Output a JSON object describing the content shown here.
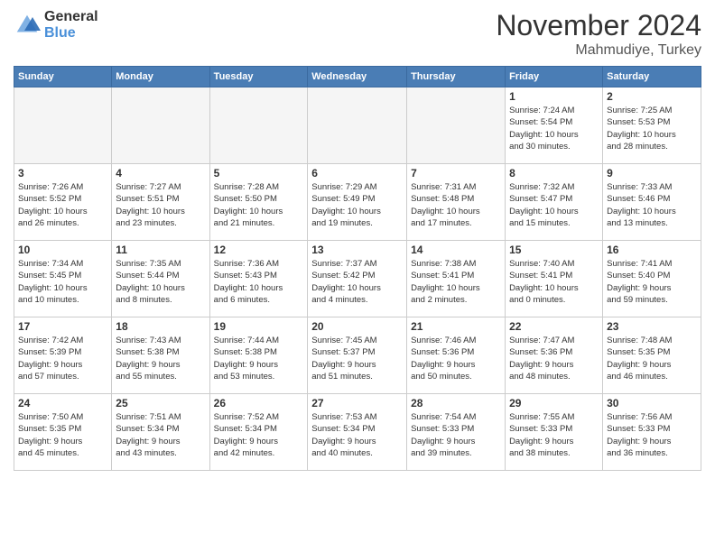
{
  "logo": {
    "general": "General",
    "blue": "Blue"
  },
  "title": "November 2024",
  "location": "Mahmudiye, Turkey",
  "weekdays": [
    "Sunday",
    "Monday",
    "Tuesday",
    "Wednesday",
    "Thursday",
    "Friday",
    "Saturday"
  ],
  "weeks": [
    [
      {
        "day": "",
        "empty": true
      },
      {
        "day": "",
        "empty": true
      },
      {
        "day": "",
        "empty": true
      },
      {
        "day": "",
        "empty": true
      },
      {
        "day": "",
        "empty": true
      },
      {
        "day": "1",
        "info": "Sunrise: 7:24 AM\nSunset: 5:54 PM\nDaylight: 10 hours\nand 30 minutes."
      },
      {
        "day": "2",
        "info": "Sunrise: 7:25 AM\nSunset: 5:53 PM\nDaylight: 10 hours\nand 28 minutes."
      }
    ],
    [
      {
        "day": "3",
        "info": "Sunrise: 7:26 AM\nSunset: 5:52 PM\nDaylight: 10 hours\nand 26 minutes."
      },
      {
        "day": "4",
        "info": "Sunrise: 7:27 AM\nSunset: 5:51 PM\nDaylight: 10 hours\nand 23 minutes."
      },
      {
        "day": "5",
        "info": "Sunrise: 7:28 AM\nSunset: 5:50 PM\nDaylight: 10 hours\nand 21 minutes."
      },
      {
        "day": "6",
        "info": "Sunrise: 7:29 AM\nSunset: 5:49 PM\nDaylight: 10 hours\nand 19 minutes."
      },
      {
        "day": "7",
        "info": "Sunrise: 7:31 AM\nSunset: 5:48 PM\nDaylight: 10 hours\nand 17 minutes."
      },
      {
        "day": "8",
        "info": "Sunrise: 7:32 AM\nSunset: 5:47 PM\nDaylight: 10 hours\nand 15 minutes."
      },
      {
        "day": "9",
        "info": "Sunrise: 7:33 AM\nSunset: 5:46 PM\nDaylight: 10 hours\nand 13 minutes."
      }
    ],
    [
      {
        "day": "10",
        "info": "Sunrise: 7:34 AM\nSunset: 5:45 PM\nDaylight: 10 hours\nand 10 minutes."
      },
      {
        "day": "11",
        "info": "Sunrise: 7:35 AM\nSunset: 5:44 PM\nDaylight: 10 hours\nand 8 minutes."
      },
      {
        "day": "12",
        "info": "Sunrise: 7:36 AM\nSunset: 5:43 PM\nDaylight: 10 hours\nand 6 minutes."
      },
      {
        "day": "13",
        "info": "Sunrise: 7:37 AM\nSunset: 5:42 PM\nDaylight: 10 hours\nand 4 minutes."
      },
      {
        "day": "14",
        "info": "Sunrise: 7:38 AM\nSunset: 5:41 PM\nDaylight: 10 hours\nand 2 minutes."
      },
      {
        "day": "15",
        "info": "Sunrise: 7:40 AM\nSunset: 5:41 PM\nDaylight: 10 hours\nand 0 minutes."
      },
      {
        "day": "16",
        "info": "Sunrise: 7:41 AM\nSunset: 5:40 PM\nDaylight: 9 hours\nand 59 minutes."
      }
    ],
    [
      {
        "day": "17",
        "info": "Sunrise: 7:42 AM\nSunset: 5:39 PM\nDaylight: 9 hours\nand 57 minutes."
      },
      {
        "day": "18",
        "info": "Sunrise: 7:43 AM\nSunset: 5:38 PM\nDaylight: 9 hours\nand 55 minutes."
      },
      {
        "day": "19",
        "info": "Sunrise: 7:44 AM\nSunset: 5:38 PM\nDaylight: 9 hours\nand 53 minutes."
      },
      {
        "day": "20",
        "info": "Sunrise: 7:45 AM\nSunset: 5:37 PM\nDaylight: 9 hours\nand 51 minutes."
      },
      {
        "day": "21",
        "info": "Sunrise: 7:46 AM\nSunset: 5:36 PM\nDaylight: 9 hours\nand 50 minutes."
      },
      {
        "day": "22",
        "info": "Sunrise: 7:47 AM\nSunset: 5:36 PM\nDaylight: 9 hours\nand 48 minutes."
      },
      {
        "day": "23",
        "info": "Sunrise: 7:48 AM\nSunset: 5:35 PM\nDaylight: 9 hours\nand 46 minutes."
      }
    ],
    [
      {
        "day": "24",
        "info": "Sunrise: 7:50 AM\nSunset: 5:35 PM\nDaylight: 9 hours\nand 45 minutes."
      },
      {
        "day": "25",
        "info": "Sunrise: 7:51 AM\nSunset: 5:34 PM\nDaylight: 9 hours\nand 43 minutes."
      },
      {
        "day": "26",
        "info": "Sunrise: 7:52 AM\nSunset: 5:34 PM\nDaylight: 9 hours\nand 42 minutes."
      },
      {
        "day": "27",
        "info": "Sunrise: 7:53 AM\nSunset: 5:34 PM\nDaylight: 9 hours\nand 40 minutes."
      },
      {
        "day": "28",
        "info": "Sunrise: 7:54 AM\nSunset: 5:33 PM\nDaylight: 9 hours\nand 39 minutes."
      },
      {
        "day": "29",
        "info": "Sunrise: 7:55 AM\nSunset: 5:33 PM\nDaylight: 9 hours\nand 38 minutes."
      },
      {
        "day": "30",
        "info": "Sunrise: 7:56 AM\nSunset: 5:33 PM\nDaylight: 9 hours\nand 36 minutes."
      }
    ]
  ]
}
